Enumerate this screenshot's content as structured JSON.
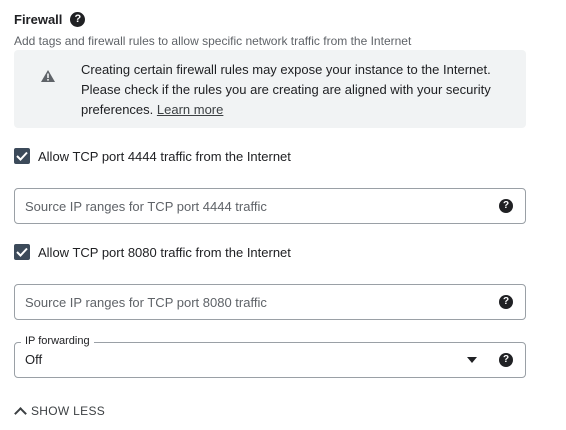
{
  "firewall": {
    "title": "Firewall",
    "help_glyph": "?",
    "subtitle": "Add tags and firewall rules to allow specific network traffic from the Internet"
  },
  "warning": {
    "icon": "warning-icon",
    "text": "Creating certain firewall rules may expose your instance to the Internet. Please check if the rules you are creating are aligned with your security preferences.",
    "link": "Learn more"
  },
  "rules": [
    {
      "checkbox_label": "Allow TCP port 4444 traffic from the Internet",
      "checked": true,
      "placeholder": "Source IP ranges for TCP port 4444 traffic",
      "value": ""
    },
    {
      "checkbox_label": "Allow TCP port 8080 traffic from the Internet",
      "checked": true,
      "placeholder": "Source IP ranges for TCP port 8080 traffic",
      "value": ""
    }
  ],
  "ip_forwarding": {
    "label": "IP forwarding",
    "value": "Off"
  },
  "show_less": "SHOW LESS",
  "colors": {
    "checkbox": "#3c4a5a",
    "warning_bg": "#f1f3f4",
    "border": "#9aa0a6"
  }
}
